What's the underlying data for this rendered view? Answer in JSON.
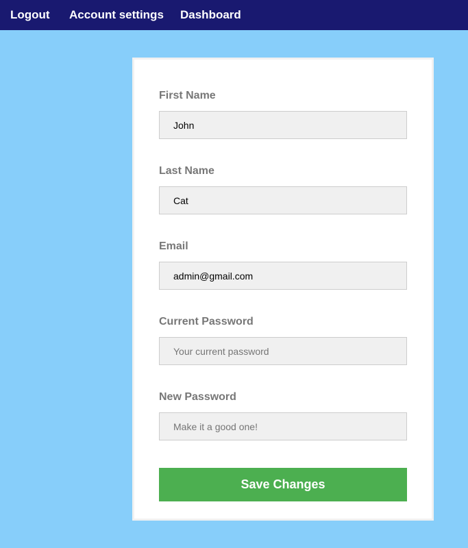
{
  "nav": {
    "logout": "Logout",
    "account_settings": "Account settings",
    "dashboard": "Dashboard"
  },
  "form": {
    "first_name": {
      "label": "First Name",
      "value": "John",
      "placeholder": ""
    },
    "last_name": {
      "label": "Last Name",
      "value": "Cat",
      "placeholder": ""
    },
    "email": {
      "label": "Email",
      "value": "admin@gmail.com",
      "placeholder": ""
    },
    "current_password": {
      "label": "Current Password",
      "value": "",
      "placeholder": "Your current password"
    },
    "new_password": {
      "label": "New Password",
      "value": "",
      "placeholder": "Make it a good one!"
    },
    "save_label": "Save Changes"
  },
  "colors": {
    "nav_background": "#191970",
    "page_background": "#87cefa",
    "card_background": "#ffffff",
    "label_text": "#777777",
    "input_background": "#f0f0f0",
    "button_background": "#4caf50",
    "button_text": "#ffffff"
  }
}
